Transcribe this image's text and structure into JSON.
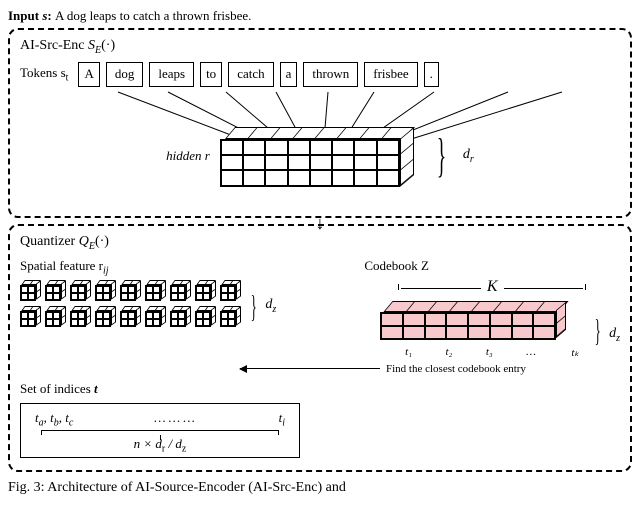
{
  "input": {
    "label_prefix": "Input ",
    "symbol": "s",
    "colon": ": ",
    "sentence": "A dog leaps to catch a thrown frisbee."
  },
  "encoder": {
    "title_prefix": "AI-Src-Enc ",
    "title_math": "S",
    "title_sub": "E",
    "title_suffix": "(·)",
    "tokens_label": "Tokens s",
    "tokens_label_sub": "t",
    "tokens": [
      "A",
      "dog",
      "leaps",
      "to",
      "catch",
      "a",
      "thrown",
      "frisbee",
      "."
    ],
    "hidden_label": "hidden r",
    "dr_label": "d",
    "dr_sub": "r"
  },
  "quantizer": {
    "title_prefix": "Quantizer ",
    "title_math": "Q",
    "title_sub": "E",
    "title_suffix": "(·)",
    "spatial_label": "Spatial feature r",
    "spatial_sub": "ij",
    "dz_label": "d",
    "dz_sub": "z",
    "codebook_label": "Codebook Z",
    "k_label": "K",
    "codebook_entries": [
      "t₁",
      "t₂",
      "t₃",
      "…",
      "tₖ"
    ],
    "find_text": "Find the closest codebook entry",
    "indices_label": "Set of indices ",
    "indices_symbol": "t",
    "indices_items": "tₐ, t_b, t_c       ……      tᵢ",
    "indices_a": "t",
    "indices_a_sub": "a",
    "indices_b": "t",
    "indices_b_sub": "b",
    "indices_c": "t",
    "indices_c_sub": "c",
    "indices_dots": "………",
    "indices_i": "t",
    "indices_i_sub": "i",
    "indices_count": "n × d_r / d_z",
    "indices_count_pre": "n × d",
    "indices_count_mid": " / d",
    "indices_count_rsub": "r",
    "indices_count_zsub": "z"
  },
  "caption": "Fig. 3: Architecture of AI-Source-Encoder (AI-Src-Enc) and"
}
